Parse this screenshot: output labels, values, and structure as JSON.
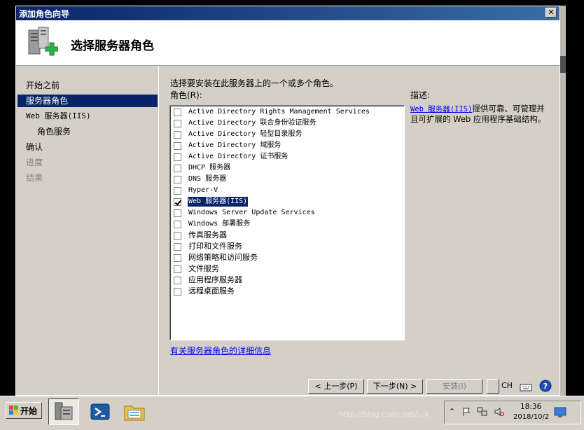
{
  "window": {
    "title": "添加角色向导",
    "close_label": "✕",
    "header_title": "选择服务器角色"
  },
  "nav": [
    {
      "label": "开始之前",
      "state": "normal"
    },
    {
      "label": "服务器角色",
      "state": "selected"
    },
    {
      "label": "Web 服务器(IIS)",
      "state": "normal"
    },
    {
      "label": "角色服务",
      "state": "sub"
    },
    {
      "label": "确认",
      "state": "normal"
    },
    {
      "label": "进度",
      "state": "disabled"
    },
    {
      "label": "结果",
      "state": "disabled"
    }
  ],
  "main": {
    "intro": "选择要安装在此服务器上的一个或多个角色。",
    "roles_label": "角色(R):",
    "description_label": "描述:",
    "description_link": "Web 服务器(IIS)",
    "description_text": "提供可靠、可管理并且可扩展的 Web 应用程序基础结构。",
    "more_info_link": "有关服务器角色的详细信息"
  },
  "roles": [
    {
      "label": "Active Directory Rights Management Services",
      "checked": false,
      "selected": false
    },
    {
      "label": "Active Directory 联合身份验证服务",
      "checked": false,
      "selected": false
    },
    {
      "label": "Active Directory 轻型目录服务",
      "checked": false,
      "selected": false
    },
    {
      "label": "Active Directory 域服务",
      "checked": false,
      "selected": false
    },
    {
      "label": "Active Directory 证书服务",
      "checked": false,
      "selected": false
    },
    {
      "label": "DHCP 服务器",
      "checked": false,
      "selected": false
    },
    {
      "label": "DNS 服务器",
      "checked": false,
      "selected": false
    },
    {
      "label": "Hyper-V",
      "checked": false,
      "selected": false
    },
    {
      "label": "Web 服务器(IIS)",
      "checked": true,
      "selected": true
    },
    {
      "label": "Windows Server Update Services",
      "checked": false,
      "selected": false
    },
    {
      "label": "Windows 部署服务",
      "checked": false,
      "selected": false
    },
    {
      "label": "传真服务器",
      "checked": false,
      "selected": false
    },
    {
      "label": "打印和文件服务",
      "checked": false,
      "selected": false
    },
    {
      "label": "网络策略和访问服务",
      "checked": false,
      "selected": false
    },
    {
      "label": "文件服务",
      "checked": false,
      "selected": false
    },
    {
      "label": "应用程序服务器",
      "checked": false,
      "selected": false
    },
    {
      "label": "远程桌面服务",
      "checked": false,
      "selected": false
    }
  ],
  "buttons": {
    "prev": "< 上一步(P)",
    "next": "下一步(N) >",
    "install": "安装(I)"
  },
  "language_bar": {
    "lang": "CH"
  },
  "taskbar": {
    "start_label": "开始",
    "time": "18:36",
    "date": "2018/10/2",
    "watermark": "http://blog.csdn.net/...k"
  },
  "icons": [
    "server-roles-icon",
    "windows-flag-icon",
    "server-manager-icon",
    "powershell-icon",
    "explorer-icon",
    "flag-icon",
    "network-icon",
    "speaker-muted-icon",
    "help-icon"
  ]
}
